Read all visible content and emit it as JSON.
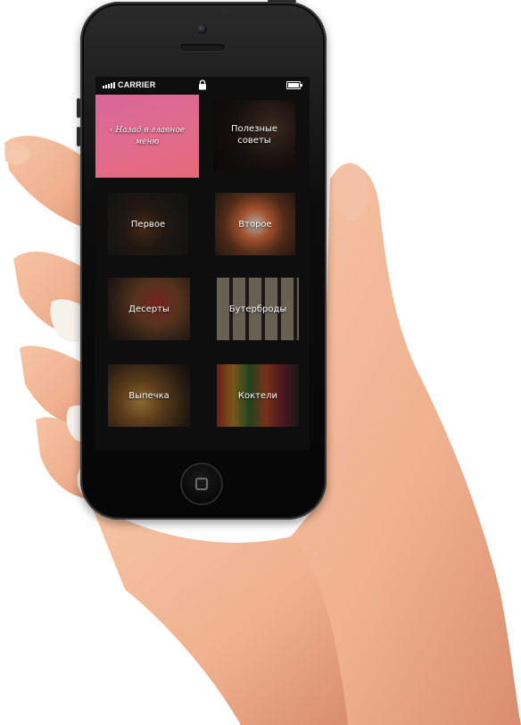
{
  "status_bar": {
    "carrier": "CARRIER"
  },
  "menu": {
    "back": "‹ Назад в главное меню",
    "tips": "Полезные советы",
    "first": "Первое",
    "second": "Второе",
    "desserts": "Десерты",
    "sandwiches": "Бутерброды",
    "pastry": "Выпечка",
    "cocktails": "Коктели"
  },
  "colors": {
    "back_tile": "#e06b8e",
    "skin": "#f1b897"
  },
  "icons": [
    "signal-icon",
    "lock-icon",
    "battery-icon",
    "home-button-icon"
  ]
}
